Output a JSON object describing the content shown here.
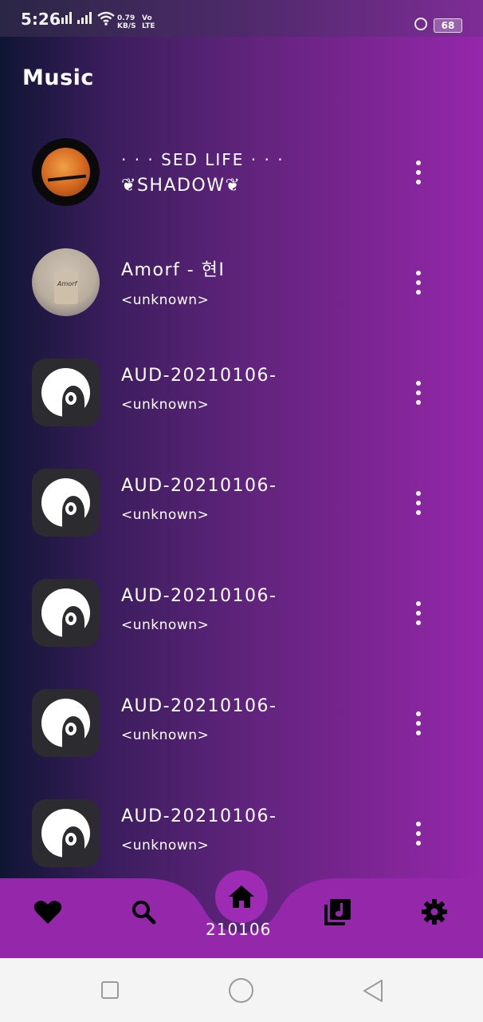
{
  "status": {
    "time": "5:26",
    "net_speed": "0.79\nKB/S",
    "net_speed_value": "0.79",
    "net_speed_unit": "KB/S",
    "volte_top": "Vo",
    "volte_bottom": "LTE",
    "battery": "68"
  },
  "header": {
    "title": "Music"
  },
  "songs": [
    {
      "title": "· · · SED LIFE · · ·",
      "subtitle": "SHADOW",
      "artist": ""
    },
    {
      "title": "Amorf - 현I",
      "artist": "<unknown>"
    },
    {
      "title": "AUD-20210106-",
      "artist": "<unknown>"
    },
    {
      "title": "AUD-20210106-",
      "artist": "<unknown>"
    },
    {
      "title": "AUD-20210106-",
      "artist": "<unknown>"
    },
    {
      "title": "AUD-20210106-",
      "artist": "<unknown>"
    },
    {
      "title": "AUD-20210106-",
      "artist": "<unknown>"
    }
  ],
  "art": {
    "amorf_text": "Amorf"
  },
  "bottom_nav": {
    "items": [
      "favorites-icon",
      "search-icon",
      "home-icon",
      "playlist-icon",
      "settings-icon"
    ],
    "now_playing_peek": "210106"
  },
  "colors": {
    "accent": "#9d2bb4",
    "nav_bar": "#9527ab",
    "background_start": "#0f1533",
    "background_end": "#9527ab"
  }
}
